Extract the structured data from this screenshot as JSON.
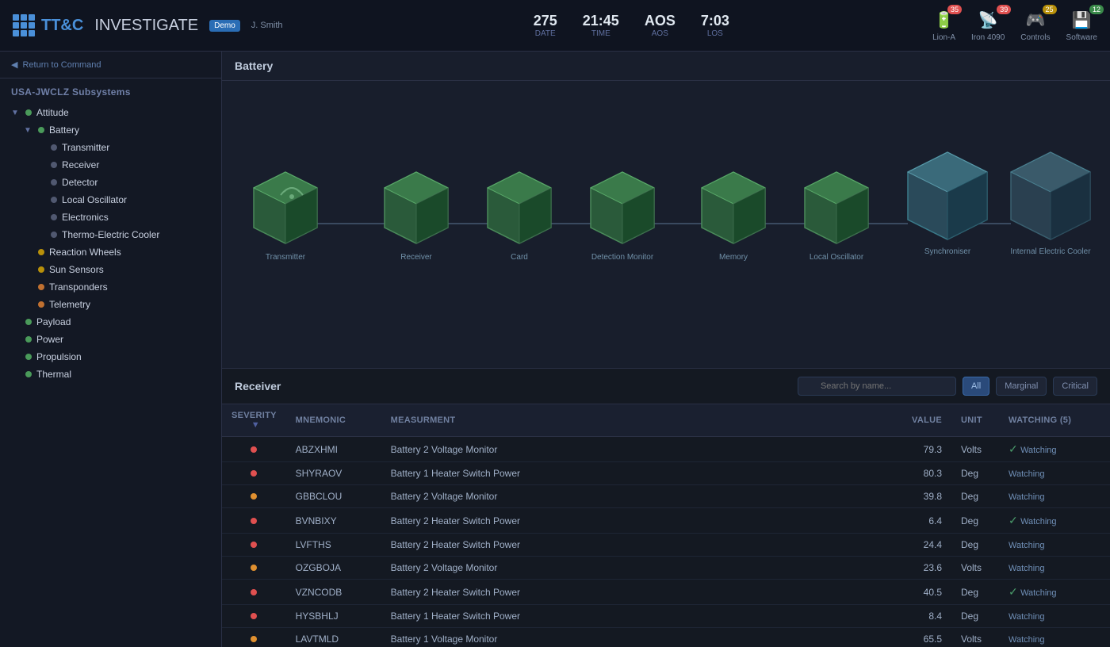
{
  "header": {
    "title_ttc": "TT&C",
    "title_investigate": "INVESTIGATE",
    "badge": "Demo",
    "user": "J. Smith",
    "stats": [
      {
        "value": "275",
        "label": "Date"
      },
      {
        "value": "21:45",
        "label": "Time"
      },
      {
        "value": "AOS",
        "label": "AOS"
      },
      {
        "value": "7:03",
        "label": "LOS"
      }
    ],
    "indicators": [
      {
        "label": "Lion-A",
        "badge": "35",
        "badge_type": "red",
        "dot_color": "#e05050"
      },
      {
        "label": "Iron 4090",
        "badge": "39",
        "badge_type": "red",
        "dot_color": "#e09030"
      },
      {
        "label": "Controls",
        "badge": "25",
        "badge_type": "yellow",
        "dot_color": "#d0c030"
      },
      {
        "label": "Software",
        "badge": "12",
        "badge_type": "green",
        "dot_color": "#40c060"
      }
    ]
  },
  "sidebar": {
    "back_label": "Return to Command",
    "section_title": "USA-JWCLZ Subsystems",
    "tree": [
      {
        "label": "Attitude",
        "level": 0,
        "dot": "green",
        "expanded": true
      },
      {
        "label": "Battery",
        "level": 1,
        "dot": "green",
        "expanded": true
      },
      {
        "label": "Transmitter",
        "level": 2,
        "dot": "gray"
      },
      {
        "label": "Receiver",
        "level": 2,
        "dot": "gray"
      },
      {
        "label": "Detector",
        "level": 2,
        "dot": "gray"
      },
      {
        "label": "Local Oscillator",
        "level": 2,
        "dot": "gray"
      },
      {
        "label": "Electronics",
        "level": 2,
        "dot": "gray"
      },
      {
        "label": "Thermo-Electric Cooler",
        "level": 2,
        "dot": "gray"
      },
      {
        "label": "Reaction Wheels",
        "level": 1,
        "dot": "yellow"
      },
      {
        "label": "Sun Sensors",
        "level": 1,
        "dot": "yellow"
      },
      {
        "label": "Transponders",
        "level": 1,
        "dot": "orange"
      },
      {
        "label": "Telemetry",
        "level": 1,
        "dot": "orange"
      },
      {
        "label": "Payload",
        "level": 0,
        "dot": "green"
      },
      {
        "label": "Power",
        "level": 0,
        "dot": "green"
      },
      {
        "label": "Propulsion",
        "level": 0,
        "dot": "green"
      },
      {
        "label": "Thermal",
        "level": 0,
        "dot": "green"
      }
    ]
  },
  "battery_panel": {
    "title": "Battery",
    "components": [
      {
        "label": "Transmitter"
      },
      {
        "label": "Receiver"
      },
      {
        "label": "Card"
      },
      {
        "label": "Detection Monitor"
      },
      {
        "label": "Memory"
      },
      {
        "label": "Local Oscillator"
      },
      {
        "label": "Synchroniser"
      },
      {
        "label": "Internal Electric Cooler"
      }
    ]
  },
  "receiver_panel": {
    "title": "Receiver",
    "search_placeholder": "Search by name...",
    "filters": [
      {
        "label": "All",
        "active": true
      },
      {
        "label": "Marginal",
        "active": false
      },
      {
        "label": "Critical",
        "active": false
      }
    ],
    "table": {
      "columns": [
        "Severity",
        "Mnemonic",
        "Measurment",
        "Value",
        "Unit",
        "Watching (5)"
      ],
      "rows": [
        {
          "severity_dot": "#e05050",
          "mnemonic": "ABZXHMI",
          "measurement": "Battery 2 Voltage Monitor",
          "value": "79.3",
          "unit": "Volts",
          "watching": true
        },
        {
          "severity_dot": "#e05050",
          "mnemonic": "SHYRAOV",
          "measurement": "Battery 1 Heater Switch Power",
          "value": "80.3",
          "unit": "Deg",
          "watching": false
        },
        {
          "severity_dot": "#e09030",
          "mnemonic": "GBBCLOU",
          "measurement": "Battery 2 Voltage Monitor",
          "value": "39.8",
          "unit": "Deg",
          "watching": false
        },
        {
          "severity_dot": "#e05050",
          "mnemonic": "BVNBIXY",
          "measurement": "Battery 2 Heater Switch Power",
          "value": "6.4",
          "unit": "Deg",
          "watching": true
        },
        {
          "severity_dot": "#e05050",
          "mnemonic": "LVFTHS",
          "measurement": "Battery 2 Heater Switch Power",
          "value": "24.4",
          "unit": "Deg",
          "watching": false
        },
        {
          "severity_dot": "#e09030",
          "mnemonic": "OZGBOJA",
          "measurement": "Battery 2 Voltage Monitor",
          "value": "23.6",
          "unit": "Volts",
          "watching": false
        },
        {
          "severity_dot": "#e05050",
          "mnemonic": "VZNCODB",
          "measurement": "Battery 2 Heater Switch Power",
          "value": "40.5",
          "unit": "Deg",
          "watching": true
        },
        {
          "severity_dot": "#e05050",
          "mnemonic": "HYSBHLJ",
          "measurement": "Battery 1 Heater Switch Power",
          "value": "8.4",
          "unit": "Deg",
          "watching": false
        },
        {
          "severity_dot": "#e09030",
          "mnemonic": "LAVTMLD",
          "measurement": "Battery 1 Voltage Monitor",
          "value": "65.5",
          "unit": "Volts",
          "watching": false
        }
      ]
    }
  }
}
